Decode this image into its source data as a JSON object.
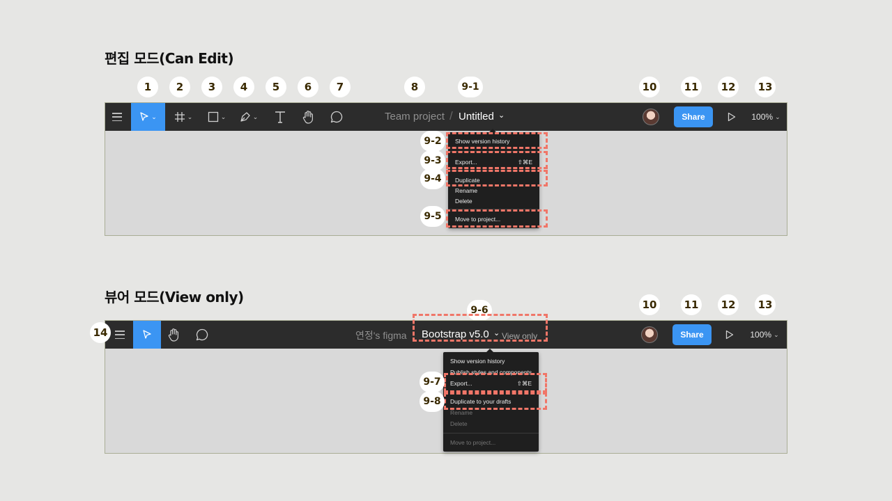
{
  "sections": {
    "edit_title": "편집 모드(Can Edit)",
    "view_title": "뷰어 모드(View only)"
  },
  "badges": {
    "b1": "1",
    "b2": "2",
    "b3": "3",
    "b4": "4",
    "b5": "5",
    "b6": "6",
    "b7": "7",
    "b8": "8",
    "b9_1": "9-1",
    "b9_2": "9-2",
    "b9_3": "9-3",
    "b9_4": "9-4",
    "b9_5": "9-5",
    "b9_6": "9-6",
    "b9_7": "9-7",
    "b9_8": "9-8",
    "b10": "10",
    "b11": "11",
    "b12": "12",
    "b13": "13",
    "b14": "14"
  },
  "edit_toolbar": {
    "team": "Team project",
    "separator": "/",
    "file": "Untitled",
    "file_chevron": "⌄",
    "share": "Share",
    "zoom": "100%",
    "icons": [
      "menu-icon",
      "move-icon",
      "frame-icon",
      "shape-icon",
      "pen-icon",
      "text-icon",
      "hand-icon",
      "comment-icon",
      "avatar",
      "play-icon"
    ],
    "accent": "#3b95f3"
  },
  "edit_menu": {
    "items": [
      {
        "label": "Show version history"
      },
      {
        "label": "Export...",
        "shortcut": "⇧⌘E"
      },
      {
        "label": "Duplicate"
      },
      {
        "label": "Rename"
      },
      {
        "label": "Delete"
      },
      {
        "label": "Move to project..."
      }
    ]
  },
  "view_toolbar": {
    "team": "연정's figma",
    "file": "Bootstrap v5.0",
    "file_chevron": "⌄",
    "view_only": "View only",
    "share": "Share",
    "zoom": "100%"
  },
  "view_menu": {
    "items": [
      {
        "label": "Show version history"
      },
      {
        "label": "Publish styles and components"
      },
      {
        "label": "Export...",
        "shortcut": "⇧⌘E"
      },
      {
        "label": "Duplicate to your drafts"
      },
      {
        "label": "Rename"
      },
      {
        "label": "Delete"
      },
      {
        "label": "Move to project..."
      }
    ]
  },
  "colors": {
    "highlight_dash": "#f07668",
    "toolbar_bg": "#2c2c2c",
    "canvas_bg": "#d9d9d9"
  }
}
